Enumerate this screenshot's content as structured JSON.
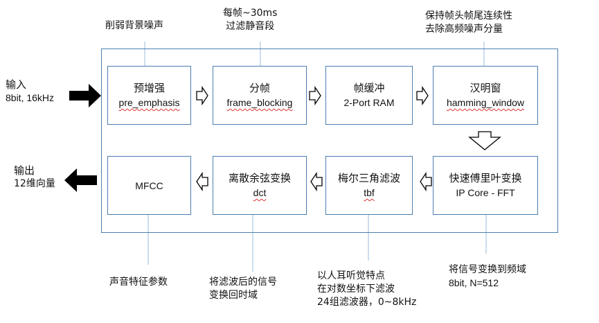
{
  "io": {
    "input": {
      "label": "输入",
      "spec": "8bit, 16kHz"
    },
    "output": {
      "label": "输出",
      "spec": "12维向量"
    }
  },
  "blocks": {
    "preemphasis": {
      "zh": "预增强",
      "en": "pre_emphasis"
    },
    "framing": {
      "zh": "分帧",
      "en": "frame_blocking"
    },
    "buffer": {
      "zh": "帧缓冲",
      "en": "2-Port RAM"
    },
    "hamming": {
      "zh": "汉明窗",
      "en": "hamming_window"
    },
    "fft": {
      "zh": "快速傅里叶变换",
      "en": "IP Core - FFT"
    },
    "tbf": {
      "zh": "梅尔三角滤波",
      "en": "tbf"
    },
    "dct": {
      "zh": "离散余弦变换",
      "en": "dct"
    },
    "mfcc": {
      "zh": "",
      "en": "MFCC"
    }
  },
  "notes": {
    "preemphasis": [
      "削弱背景噪声"
    ],
    "framing": [
      "每帧~30ms",
      "过滤静音段"
    ],
    "hamming": [
      "保持帧头帧尾连续性",
      "去除高频噪声分量"
    ],
    "mfcc": [
      "声音特征参数"
    ],
    "dct": [
      "将滤波后的信号",
      "变换回时域"
    ],
    "tbf": [
      "以人耳听觉特点",
      "在对数坐标下滤波",
      "24组滤波器，0~8kHz"
    ],
    "fft": [
      "将信号变换到频域",
      "8bit, N=512"
    ]
  }
}
